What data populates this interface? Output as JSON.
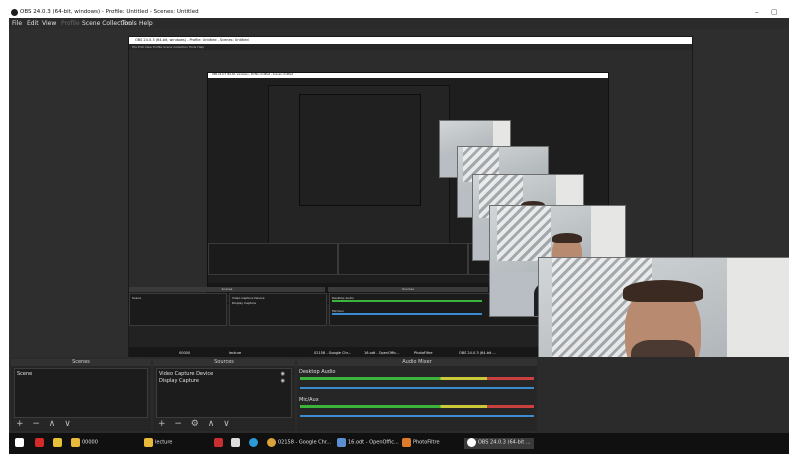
{
  "window": {
    "title": "OBS 24.0.3 (64-bit, windows) - Profile: Untitled - Scenes: Untitled",
    "controls": {
      "minimize": "–",
      "maximize": "▢",
      "close": "✕"
    }
  },
  "menu": [
    "File",
    "Edit",
    "View",
    "Profile",
    "Scene Collection",
    "Tools",
    "Help"
  ],
  "nested": {
    "title": "OBS 24.0.3 (64-bit, windows) - Profile: Untitled - Scenes: Untitled",
    "menu": "File   Edit   View   Profile   Scene Collection   Tools   Help",
    "scenes_header": "Scenes",
    "sources_header": "Sources",
    "mixer_header": "Audio Mixer",
    "scene_item": "Scene",
    "sources": [
      "Video Capture Device",
      "Display Capture"
    ],
    "mixer": [
      "Desktop Audio",
      "Mic/Aux"
    ],
    "taskbar": [
      "00000",
      "lecture",
      "02158 - Google Chr...",
      "16.odt - OpenOffic...",
      "PhotoFiltre",
      "OBS 24.0.3 (64-bit ..."
    ]
  },
  "scenes": {
    "header": "Scenes",
    "items": [
      "Scene"
    ],
    "tools": "+ − ∧ ∨"
  },
  "sources": {
    "header": "Sources",
    "items": [
      "Video Capture Device",
      "Display Capture"
    ],
    "tools": "+ − ⚙ ∧ ∨"
  },
  "mixer": {
    "header": "Audio Mixer",
    "channels": [
      {
        "name": "Desktop Audio",
        "level": 0.6
      },
      {
        "name": "Mic/Aux",
        "level": 0.45
      }
    ]
  },
  "taskbar": {
    "items": [
      {
        "label": "00000",
        "icon": "folder-icon",
        "color": "#e8b93a"
      },
      {
        "label": "lecture",
        "icon": "folder-icon",
        "color": "#e8b93a"
      },
      {
        "label": "02158 - Google Chr...",
        "icon": "chrome-icon",
        "color": "#d9a23a"
      },
      {
        "label": "16.odt - OpenOffic...",
        "icon": "writer-icon",
        "color": "#5a8fd0"
      },
      {
        "label": "PhotoFiltre",
        "icon": "photofiltre-icon",
        "color": "#e07b2a"
      },
      {
        "label": "OBS 24.0.3 (64-bit ...",
        "icon": "obs-icon",
        "color": "#222222"
      }
    ]
  },
  "colors": {
    "panel": "#262626",
    "background": "#2b2b2b",
    "accent": "#3a8ccf"
  }
}
